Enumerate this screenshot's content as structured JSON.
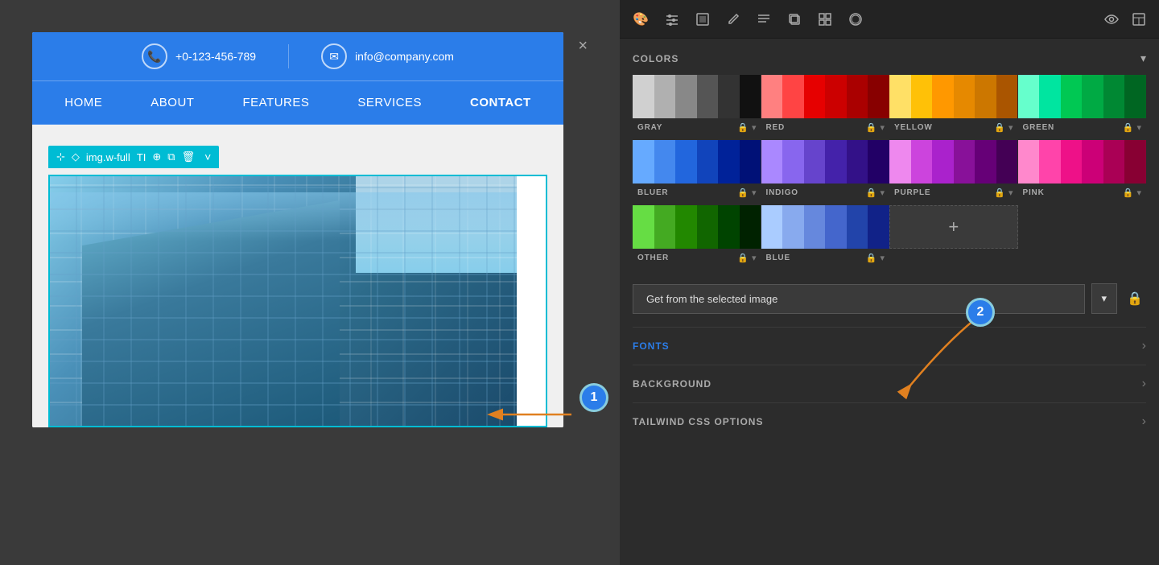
{
  "left": {
    "close_label": "×",
    "topbar": {
      "phone_icon": "☎",
      "phone": "+0-123-456-789",
      "email_icon": "✉",
      "email": "info@company.com"
    },
    "nav": {
      "items": [
        "HOME",
        "ABOUT",
        "FEATURES",
        "SERVICES",
        "CONTACT"
      ]
    },
    "image_toolbar": {
      "move_icon": "⊹",
      "diamond_icon": "◇",
      "label": "img.w-full",
      "text_icon": "TI",
      "target_icon": "⊕",
      "copy_icon": "⧉",
      "trash_icon": "🗑",
      "chevron": "˅"
    }
  },
  "right": {
    "toolbar": {
      "icons": [
        "🎨",
        "⚙",
        "▣",
        "✏",
        "≡☰",
        "⧉",
        "⊞",
        "Ⓦ"
      ],
      "right_icons": [
        "👁",
        "⊡"
      ]
    },
    "colors": {
      "title": "COLORS",
      "chevron": "˅",
      "groups_row1": [
        {
          "name": "GRAY",
          "swatches": [
            "#d0d0d0",
            "#b0b0b0",
            "#888",
            "#555",
            "#333",
            "#111"
          ]
        },
        {
          "name": "RED",
          "swatches": [
            "#ff8080",
            "#ff4444",
            "#e60000",
            "#cc0000",
            "#aa0000",
            "#880000"
          ]
        },
        {
          "name": "YELLOW",
          "swatches": [
            "#ffe066",
            "#ffc107",
            "#ff9800",
            "#e68900",
            "#cc7700",
            "#aa5500"
          ]
        },
        {
          "name": "GREEN",
          "swatches": [
            "#66ffcc",
            "#00e5a0",
            "#00c853",
            "#00aa44",
            "#008833",
            "#006622"
          ]
        }
      ],
      "groups_row2": [
        {
          "name": "BLUER",
          "swatches": [
            "#66aaff",
            "#4488ee",
            "#2266dd",
            "#1144bb",
            "#002299",
            "#001177"
          ]
        },
        {
          "name": "INDIGO",
          "swatches": [
            "#aa88ff",
            "#8866ee",
            "#6644cc",
            "#4422aa",
            "#331188",
            "#220066"
          ]
        },
        {
          "name": "PURPLE",
          "swatches": [
            "#ee88ee",
            "#cc44dd",
            "#aa22cc",
            "#881199",
            "#660077",
            "#440055"
          ]
        },
        {
          "name": "PINK",
          "swatches": [
            "#ff88cc",
            "#ff44aa",
            "#ee1188",
            "#cc0077",
            "#aa0055",
            "#880033"
          ]
        }
      ],
      "groups_row3": [
        {
          "name": "OTHER",
          "swatches": [
            "#66dd44",
            "#44aa22",
            "#228800",
            "#116600",
            "#004400",
            "#002200"
          ]
        },
        {
          "name": "BLUE",
          "swatches": [
            "#aaccff",
            "#88aaee",
            "#6688dd",
            "#4466cc",
            "#2244aa",
            "#112288"
          ]
        }
      ],
      "add_label": "+"
    },
    "get_image_btn": "Get from the selected image",
    "get_image_chevron": "˅",
    "fonts": {
      "title": "FONTS",
      "arrow": "›"
    },
    "background": {
      "title": "BACKGROUND",
      "arrow": "›"
    },
    "tailwind": {
      "title": "TAILWIND CSS OPTIONS",
      "arrow": "›"
    }
  },
  "annotations": {
    "circle1": "1",
    "circle2": "2"
  }
}
